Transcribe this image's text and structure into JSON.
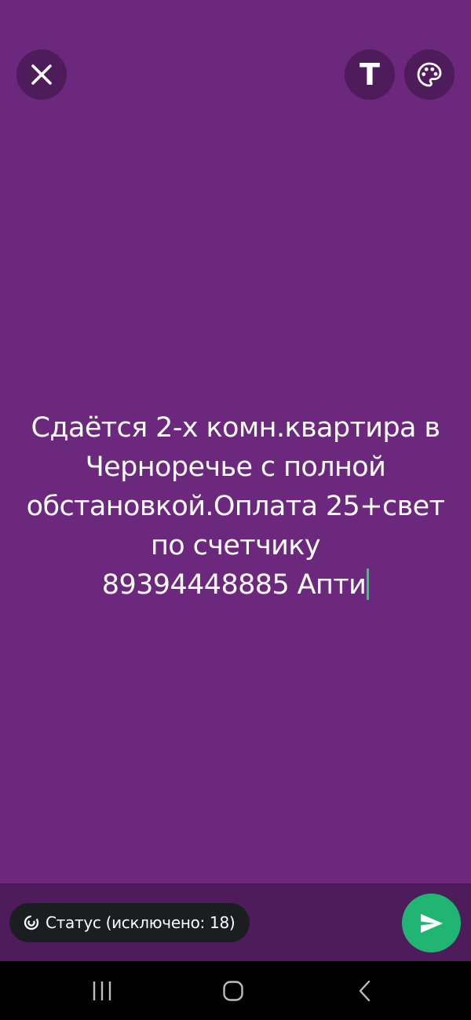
{
  "editor": {
    "background_color": "#6b287c",
    "text_lines": [
      "Сдаётся 2-х комн.квартира в",
      "Черноречье с полной",
      "обстановкой.Оплата 25+свет",
      "по счетчику",
      "89394448885 Апти"
    ],
    "cursor_color": "#25d366"
  },
  "toolbar": {
    "close_icon": "close-icon",
    "text_button_glyph": "T",
    "palette_icon": "palette-icon"
  },
  "footer": {
    "recipients_icon": "status-ring-icon",
    "recipients_label": "Статус (исключено: 18)",
    "send_icon": "send-icon",
    "send_color": "#20b573"
  },
  "navigation": {
    "recents_icon": "recents-icon",
    "home_icon": "home-icon",
    "back_icon": "back-icon"
  }
}
